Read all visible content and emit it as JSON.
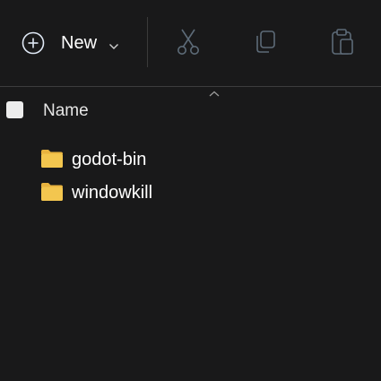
{
  "toolbar": {
    "new_label": "New",
    "icons": [
      "plus-circle-icon",
      "chevron-down-icon",
      "cut-icon",
      "copy-icon",
      "paste-icon"
    ]
  },
  "header": {
    "name_column": "Name"
  },
  "files": [
    {
      "name": "godot-bin",
      "type": "folder"
    },
    {
      "name": "windowkill",
      "type": "folder"
    }
  ],
  "colors": {
    "background": "#19191a",
    "folder": "#f3c64f",
    "disabled_icon": "#5d6b78",
    "text": "#ffffff"
  }
}
